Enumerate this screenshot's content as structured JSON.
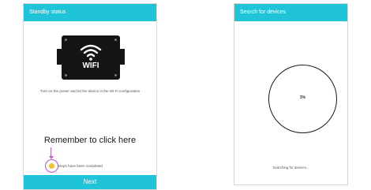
{
  "screen1": {
    "title": "Standby status",
    "device_label": "WIFI",
    "instruction": "Turn on the power and let the device in the Wi-Fi configuration",
    "callout": "Remember to click here",
    "checkbox_label": "Steps have been completed",
    "checkbox_checked": true,
    "next_label": "Next"
  },
  "screen2": {
    "title": "Search for devices",
    "progress_text": "3%",
    "progress_value": 3,
    "status_text": "Searching for devices..."
  },
  "colors": {
    "accent": "#20c4d8",
    "callout_ring": "#c54fd0",
    "checkbox": "#f2c230"
  },
  "icons": {
    "device": "wifi-module-icon",
    "wifi": "wifi-signal-icon"
  }
}
